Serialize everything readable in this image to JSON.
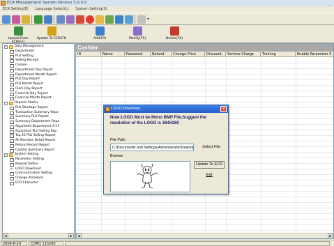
{
  "window": {
    "title": "ECR Management System  Version 3.0.0.0"
  },
  "menu": [
    "ECR Setting(E)",
    "Language Select(L)",
    "System Setting(S)"
  ],
  "toolbar_main": [
    {
      "label": "Upload From ECR(F2)",
      "icon": "upload-icon",
      "color": "#3a8f3a"
    },
    {
      "label": "Update To ECR(F3)",
      "icon": "update-icon",
      "color": "#d4a017"
    },
    {
      "label": "Add(F4)",
      "icon": "add-icon",
      "color": "#3c7fcc"
    },
    {
      "label": "Modify(F5)",
      "icon": "modify-icon",
      "color": "#8a6fc9"
    },
    {
      "label": "Delete(F6)",
      "icon": "delete-icon",
      "color": "#c03b2b"
    }
  ],
  "tree": [
    {
      "label": "Data Management",
      "level": 0,
      "type": "folder",
      "expander": "⊟"
    },
    {
      "label": "Department",
      "level": 1,
      "type": "doc"
    },
    {
      "label": "PLU Setting",
      "level": 1,
      "type": "doc"
    },
    {
      "label": "Selling Receipt",
      "level": 1,
      "type": "doc"
    },
    {
      "label": "Cashier",
      "level": 1,
      "type": "doc"
    },
    {
      "label": "Department Day Report",
      "level": 1,
      "type": "doc"
    },
    {
      "label": "Department Month Report",
      "level": 1,
      "type": "doc"
    },
    {
      "label": "PLU Day Report",
      "level": 1,
      "type": "doc"
    },
    {
      "label": "PLU Month Report",
      "level": 1,
      "type": "doc"
    },
    {
      "label": "Clerk Day Report",
      "level": 1,
      "type": "doc"
    },
    {
      "label": "Financial Day Report",
      "level": 1,
      "type": "doc"
    },
    {
      "label": "Financial Month Report",
      "level": 1,
      "type": "doc"
    },
    {
      "label": "Reports Statics",
      "level": 0,
      "type": "folder",
      "expander": "⊟"
    },
    {
      "label": "PLU Shortage Report",
      "level": 1,
      "type": "doc"
    },
    {
      "label": "Transaction Summary Repo",
      "level": 1,
      "type": "doc"
    },
    {
      "label": "Summary PLU Report",
      "level": 1,
      "type": "doc"
    },
    {
      "label": "Summary Department Repo",
      "level": 1,
      "type": "doc"
    },
    {
      "label": "Appointed Department S.Y.F",
      "level": 1,
      "type": "doc"
    },
    {
      "label": "Appointed PLU Selling Rep",
      "level": 1,
      "type": "doc"
    },
    {
      "label": "Top 25 PLU Selling Report",
      "level": 1,
      "type": "doc"
    },
    {
      "label": "All Receipts Detail Report",
      "level": 1,
      "type": "doc"
    },
    {
      "label": "Refund Record Report",
      "level": 1,
      "type": "doc"
    },
    {
      "label": "Cashier Summary Report",
      "level": 1,
      "type": "doc"
    },
    {
      "label": "System Setting",
      "level": 0,
      "type": "folder",
      "expander": "⊟"
    },
    {
      "label": "Parameter Setting",
      "level": 1,
      "type": "doc"
    },
    {
      "label": "Keypad Define",
      "level": 1,
      "type": "doc"
    },
    {
      "label": "LOGO Download",
      "level": 1,
      "type": "star"
    },
    {
      "label": "Communication Setting",
      "level": 1,
      "type": "doc"
    },
    {
      "label": "Change Password",
      "level": 1,
      "type": "doc"
    },
    {
      "label": "ECR Character",
      "level": 1,
      "type": "doc"
    }
  ],
  "grid": {
    "header": "Cashier",
    "columns": [
      "ID",
      "Name",
      "Password",
      "Refund",
      "Change Price",
      "Discount",
      "Service Charge",
      "Training",
      "Enable Parameter S"
    ]
  },
  "dialog": {
    "title": "LOGO Download",
    "note": "Note:LOGO Must be Mono BMP File,Suggest the resolution of the LOGO is 384X280",
    "file_path_label": "File Path",
    "file_path_value": "C:\\Documents and Settings\\Administrator\\Desktop\\",
    "select_file": "Select File",
    "browse_label": "Browse",
    "update_button": "Update To ECR",
    "exit_button": "Exit"
  },
  "status": {
    "date": "2009-6-29",
    "port": "COM1 115200"
  }
}
